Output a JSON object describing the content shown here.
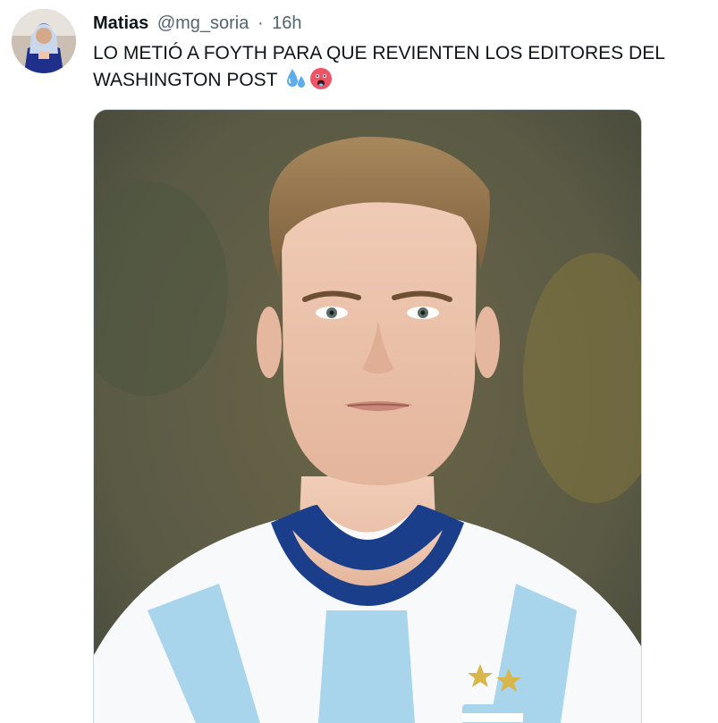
{
  "tweet": {
    "display_name": "Matias",
    "handle": "@mg_soria",
    "separator": "·",
    "time": "16h",
    "text_line1": "LO METIÓ A FOYTH PARA QUE REVIENTEN LOS EDITORES DEL",
    "text_line2": "WASHINGTON POST",
    "emojis": [
      "sweat-droplets-icon",
      "hot-face-icon"
    ]
  },
  "colors": {
    "text": "#0f1419",
    "secondary": "#536471",
    "jersey_light_blue": "#a8d4ec",
    "jersey_collar": "#1b3e8a"
  }
}
